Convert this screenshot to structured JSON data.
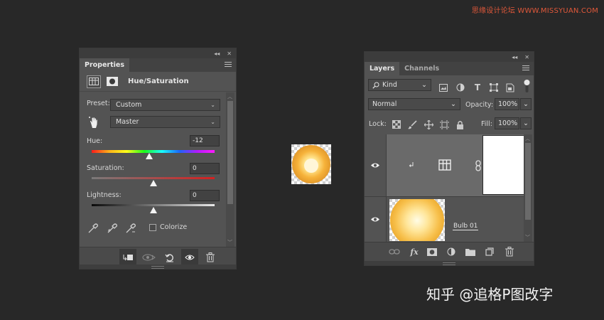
{
  "watermark_top": "思缘设计论坛 WWW.MISSYUAN.COM",
  "watermark_bottom": "知乎 @追格P图改字",
  "properties": {
    "tab": "Properties",
    "adjustment_title": "Hue/Saturation",
    "preset_label": "Preset:",
    "preset_value": "Custom",
    "channel_value": "Master",
    "hue_label": "Hue:",
    "hue_value": "-12",
    "saturation_label": "Saturation:",
    "saturation_value": "0",
    "lightness_label": "Lightness:",
    "lightness_value": "0",
    "colorize_label": "Colorize",
    "colorize_checked": false,
    "hue_slider_percent": 46.7,
    "saturation_slider_percent": 50,
    "lightness_slider_percent": 50
  },
  "layers": {
    "tabs": [
      "Layers",
      "Channels"
    ],
    "active_tab": "Layers",
    "filter_kind": "Kind",
    "blend_mode": "Normal",
    "opacity_label": "Opacity:",
    "opacity_value": "100%",
    "lock_label": "Lock:",
    "fill_label": "Fill:",
    "fill_value": "100%",
    "items": [
      {
        "name": "",
        "type": "adjustment-hue-saturation",
        "clipped": true,
        "visible": true,
        "selected": true
      },
      {
        "name": "Bulb 01",
        "type": "pixel",
        "visible": true,
        "selected": false
      }
    ]
  },
  "colors": {
    "background": "#282828",
    "panel": "#535353",
    "panel_dark": "#424242",
    "selected_layer": "#6a6a6a",
    "watermark_red": "#e0583a"
  }
}
